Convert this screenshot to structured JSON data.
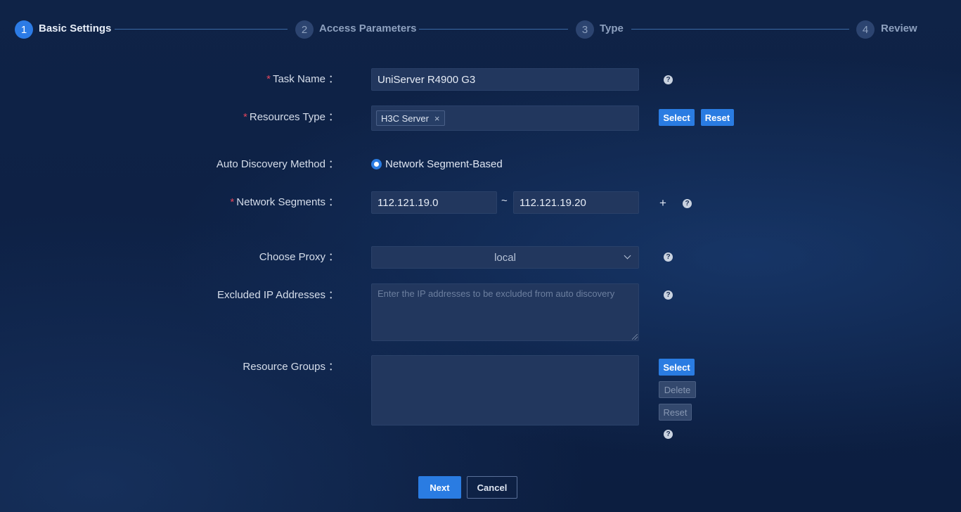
{
  "stepper": {
    "steps": [
      {
        "number": "1",
        "label": "Basic Settings",
        "active": true
      },
      {
        "number": "2",
        "label": "Access Parameters",
        "active": false
      },
      {
        "number": "3",
        "label": "Type",
        "active": false
      },
      {
        "number": "4",
        "label": "Review",
        "active": false
      }
    ]
  },
  "form": {
    "task_name": {
      "label": "Task Name",
      "value": "UniServer R4900 G3",
      "required": true,
      "help": "?"
    },
    "resources_type": {
      "label": "Resources Type",
      "required": true,
      "tag": "H3C Server",
      "tag_remove": "×",
      "select_label": "Select",
      "reset_label": "Reset"
    },
    "auto_discovery": {
      "label": "Auto Discovery Method",
      "option": "Network Segment-Based"
    },
    "network_segments": {
      "label": "Network Segments",
      "required": true,
      "start": "112.121.19.0",
      "separator": "~",
      "end": "112.121.19.20",
      "add": "+",
      "help": "?"
    },
    "proxy": {
      "label": "Choose Proxy",
      "value": "local",
      "help": "?"
    },
    "excluded_ips": {
      "label": "Excluded IP Addresses",
      "placeholder": "Enter the IP addresses to be excluded from auto discovery",
      "help": "?"
    },
    "resource_groups": {
      "label": "Resource Groups",
      "select_label": "Select",
      "delete_label": "Delete",
      "reset_label": "Reset",
      "help": "?"
    }
  },
  "colon": "：",
  "required_mark": "*",
  "footer": {
    "next_label": "Next",
    "cancel_label": "Cancel"
  },
  "colors": {
    "accent": "#2a7ce2",
    "required": "#e0455c",
    "background": "#0d2044"
  }
}
